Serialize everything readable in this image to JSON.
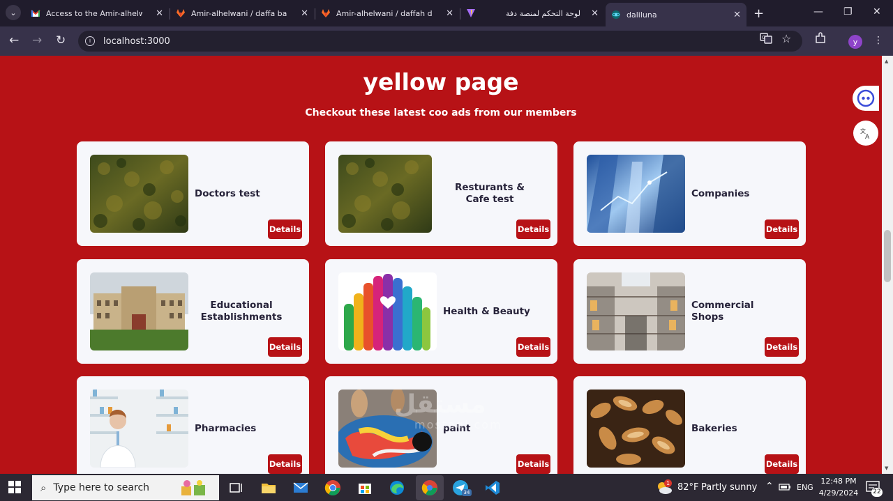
{
  "browser": {
    "tabs": [
      {
        "title": "Access to the Amir-alhelwani",
        "icon": "gmail-icon"
      },
      {
        "title": "Amir-alhelwani / daffa backend",
        "icon": "gitlab-icon"
      },
      {
        "title": "Amir-alhelwani / daffah dashboard",
        "icon": "gitlab-icon"
      },
      {
        "title": "",
        "icon": "vite-icon"
      },
      {
        "title": "لوحة التحكم لمنصة دفة",
        "icon": ""
      },
      {
        "title": "daliluna",
        "icon": "react-icon"
      }
    ],
    "url": "localhost:3000",
    "profile_initial": "y"
  },
  "page": {
    "title": "yellow page",
    "subtitle": "Checkout these latest coo ads from our members",
    "details_label": "Details",
    "cards": [
      {
        "name": "Doctors test",
        "image": "forest-image"
      },
      {
        "name": "Resturants & Cafe test",
        "image": "forest-image"
      },
      {
        "name": "Companies",
        "image": "skyscraper-image"
      },
      {
        "name": "Educational Establishments",
        "image": "school-building-image"
      },
      {
        "name": "Health & Beauty",
        "image": "colorful-hands-image"
      },
      {
        "name": "Commercial Shops",
        "image": "shopping-mall-image"
      },
      {
        "name": "Pharmacies",
        "image": "pharmacist-image"
      },
      {
        "name": "paint",
        "image": "painting-image"
      },
      {
        "name": "Bakeries",
        "image": "bread-image"
      }
    ]
  },
  "watermark": {
    "arabic": "مستقل",
    "latin": "mostaql.com"
  },
  "taskbar": {
    "search_placeholder": "Type here to search",
    "weather_temp": "82°F",
    "weather_desc": "Partly sunny",
    "lang": "ENG",
    "time": "12:48 PM",
    "date": "4/29/2024",
    "notifications": "22",
    "weather_badge": "1",
    "telegram_badge": "34"
  }
}
